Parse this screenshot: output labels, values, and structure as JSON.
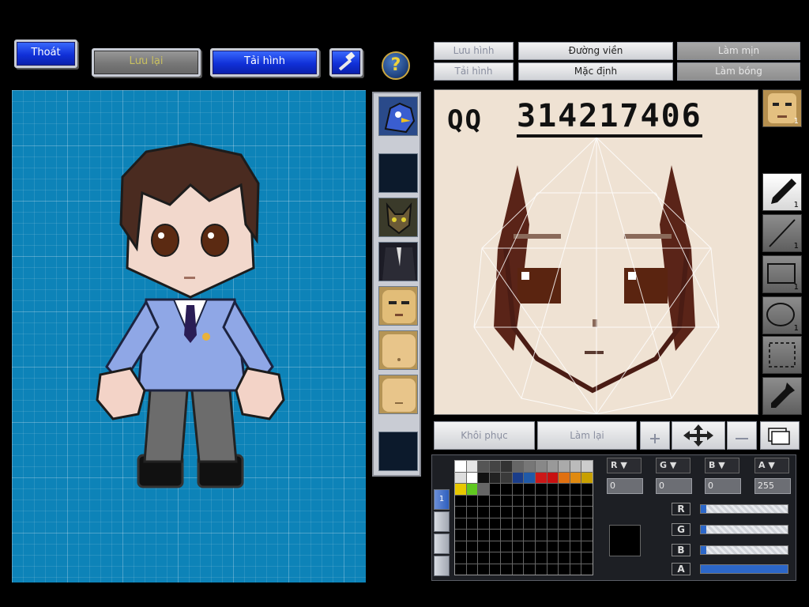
{
  "top_buttons": {
    "exit": "Thoát",
    "save": "Lưu lại",
    "load": "Tải hình",
    "help": "?"
  },
  "editor_toolbar": {
    "save_image": "Lưu hình",
    "load_image": "Tải hình",
    "outline": "Đường viền",
    "default": "Mặc định",
    "smooth": "Làm mịn",
    "shade": "Làm bóng"
  },
  "canvas_text": {
    "qq": "QQ",
    "number": "314217406"
  },
  "tools": {
    "face_count": "1",
    "pen": "1",
    "line": "1",
    "rect": "1",
    "ellipse": "1"
  },
  "actions": {
    "restore": "Khôi phục",
    "redo": "Làm lại"
  },
  "palette": {
    "colors": [
      "#ffffff",
      "#e6e6e6",
      "#555555",
      "#444444",
      "#333333",
      "#666666",
      "#777777",
      "#888888",
      "#999999",
      "#aaaaaa",
      "#bbbbbb",
      "#cccccc",
      "#dddddd",
      "#ffffff",
      "#111111",
      "#222222",
      "#3a3a3a",
      "#1a3d8a",
      "#205aa8",
      "#cc1818",
      "#c81010",
      "#e07010",
      "#e08a10",
      "#c8a000",
      "#e8c800",
      "#60c820",
      "#666666"
    ],
    "channels": {
      "r_label": "R",
      "g_label": "G",
      "b_label": "B",
      "a_label": "A"
    },
    "values": {
      "r": "0",
      "g": "0",
      "b": "0",
      "a": "255"
    },
    "levels": {
      "r": 0,
      "g": 0,
      "b": 0,
      "a": 1
    },
    "layer": "1"
  }
}
